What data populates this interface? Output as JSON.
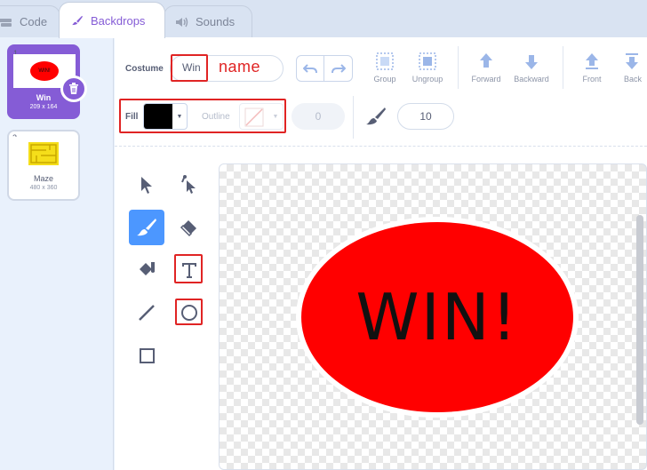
{
  "tabs": [
    {
      "label": "Code",
      "icon": "code-icon"
    },
    {
      "label": "Backdrops",
      "icon": "paintbrush-icon",
      "active": true
    },
    {
      "label": "Sounds",
      "icon": "speaker-icon"
    }
  ],
  "backdrops": [
    {
      "number": "1",
      "name": "Win",
      "size": "209 x 164",
      "thumb_text": "WIN!"
    },
    {
      "number": "2",
      "name": "Maze",
      "size": "480 x 360"
    }
  ],
  "editor": {
    "costume_label": "Costume",
    "costume_name": "Win",
    "annotation": "name",
    "toolbar": {
      "group": "Group",
      "ungroup": "Ungroup",
      "forward": "Forward",
      "backward": "Backward",
      "front": "Front",
      "back": "Back"
    },
    "fill_label": "Fill",
    "outline_label": "Outline",
    "outline_width": "0",
    "brush_size": "10",
    "canvas_text": "WIN!"
  },
  "colors": {
    "accent": "#855cd6",
    "tool_active": "#4c97ff",
    "fill": "#000000",
    "shape": "#ff0000",
    "annotation": "#e02424"
  }
}
